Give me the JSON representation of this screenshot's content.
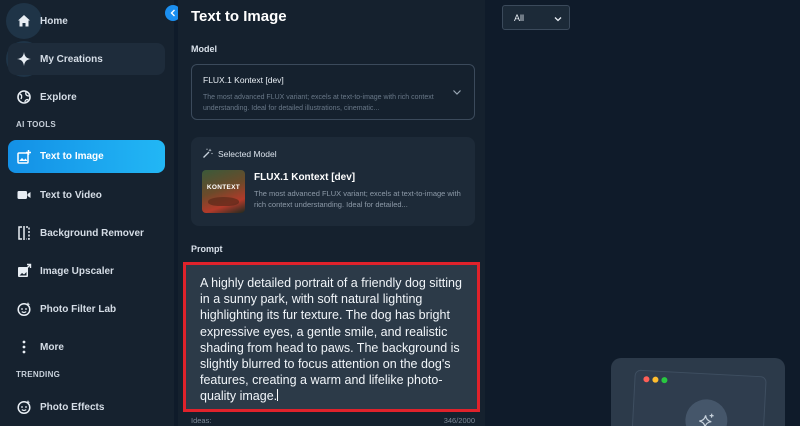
{
  "sidebar": {
    "items": [
      {
        "label": "Home",
        "icon": "home-icon"
      },
      {
        "label": "My Creations",
        "icon": "sparkle-icon"
      },
      {
        "label": "Explore",
        "icon": "globe-icon"
      },
      {
        "label": "Text to Image",
        "icon": "image-add-icon"
      },
      {
        "label": "Text to Video",
        "icon": "video-icon"
      },
      {
        "label": "Background Remover",
        "icon": "bg-remover-icon"
      },
      {
        "label": "Image Upscaler",
        "icon": "image-upscale-icon"
      },
      {
        "label": "Photo Filter Lab",
        "icon": "filter-face-icon"
      },
      {
        "label": "More",
        "icon": "more-vertical-icon"
      },
      {
        "label": "Photo Effects",
        "icon": "effects-face-icon"
      }
    ],
    "sections": {
      "ai_tools": "AI TOOLS",
      "trending": "TRENDING"
    },
    "active_item": "Text to Image",
    "accent_color": "#1a9be9"
  },
  "panel": {
    "title": "Text to Image",
    "model_label": "Model",
    "model_select": {
      "value": "FLUX.1 Kontext [dev]",
      "description": "The most advanced FLUX variant; excels at text-to-image with rich context understanding. Ideal for detailed illustrations, cinematic..."
    },
    "selected_model": {
      "header": "Selected Model",
      "name": "FLUX.1 Kontext [dev]",
      "description": "The most advanced FLUX variant; excels at text-to-image with rich context understanding. Ideal for detailed...",
      "thumbnail_text": "KONTEXT"
    },
    "prompt_label": "Prompt",
    "prompt_text": "A highly detailed portrait of a friendly dog sitting in a sunny park, with soft natural lighting highlighting its fur texture. The dog has bright expressive eyes, a gentle smile, and realistic shading from head to paws. The background is slightly blurred to focus attention on the dog's features, creating a warm and lifelike photo-quality image.",
    "ideas_label": "Ideas:",
    "char_count": "346/2000",
    "highlight_color": "#e0222b"
  },
  "filter": {
    "value": "All"
  }
}
